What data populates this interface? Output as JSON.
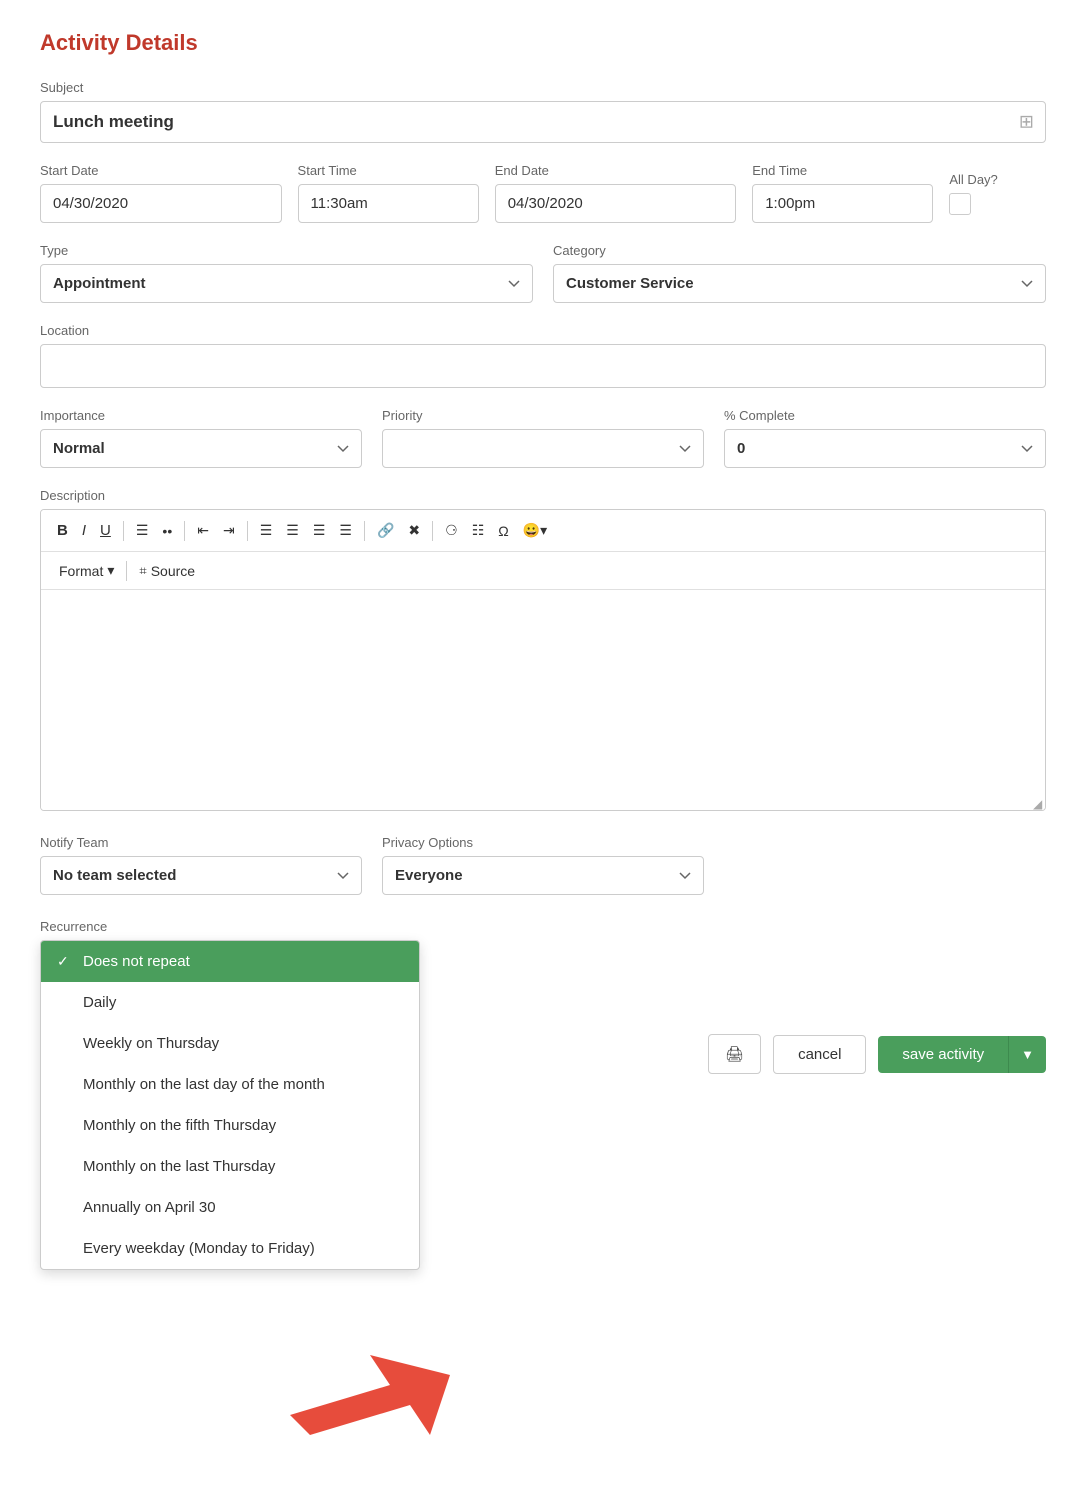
{
  "page": {
    "title": "Activity Details"
  },
  "subject": {
    "label": "Subject",
    "value": "Lunch meeting",
    "placeholder": "Subject"
  },
  "startDate": {
    "label": "Start Date",
    "value": "04/30/2020"
  },
  "startTime": {
    "label": "Start Time",
    "value": "11:30am"
  },
  "endDate": {
    "label": "End Date",
    "value": "04/30/2020"
  },
  "endTime": {
    "label": "End Time",
    "value": "1:00pm"
  },
  "allDay": {
    "label": "All Day?"
  },
  "type": {
    "label": "Type",
    "value": "Appointment"
  },
  "category": {
    "label": "Category",
    "value": "Customer Service"
  },
  "location": {
    "label": "Location",
    "value": "",
    "placeholder": ""
  },
  "importance": {
    "label": "Importance",
    "value": "Normal"
  },
  "priority": {
    "label": "Priority",
    "value": ""
  },
  "percentComplete": {
    "label": "% Complete",
    "value": "0"
  },
  "description": {
    "label": "Description",
    "format_label": "Format",
    "source_label": "Source",
    "toolbar": {
      "bold": "B",
      "italic": "I",
      "underline": "U"
    }
  },
  "notifyTeam": {
    "label": "Notify Team",
    "value": "No team selected"
  },
  "privacyOptions": {
    "label": "Privacy Options",
    "value": "Everyone"
  },
  "recurrence": {
    "label": "Recurrence",
    "options": [
      {
        "id": "does-not-repeat",
        "label": "Does not repeat",
        "selected": true
      },
      {
        "id": "daily",
        "label": "Daily",
        "selected": false
      },
      {
        "id": "weekly-thursday",
        "label": "Weekly on Thursday",
        "selected": false
      },
      {
        "id": "monthly-last-day",
        "label": "Monthly on the last day of the month",
        "selected": false
      },
      {
        "id": "monthly-fifth-thursday",
        "label": "Monthly on the fifth Thursday",
        "selected": false
      },
      {
        "id": "monthly-last-thursday",
        "label": "Monthly on the last Thursday",
        "selected": false
      },
      {
        "id": "annually-april-30",
        "label": "Annually on April 30",
        "selected": false
      },
      {
        "id": "every-weekday",
        "label": "Every weekday (Monday to Friday)",
        "selected": false
      }
    ]
  },
  "footer": {
    "print_label": "🖨",
    "cancel_label": "cancel",
    "save_label": "save activity",
    "save_arrow": "▼"
  },
  "colors": {
    "title": "#c0392b",
    "green": "#4a9e5c",
    "selected_bg": "#4a9e5c"
  }
}
